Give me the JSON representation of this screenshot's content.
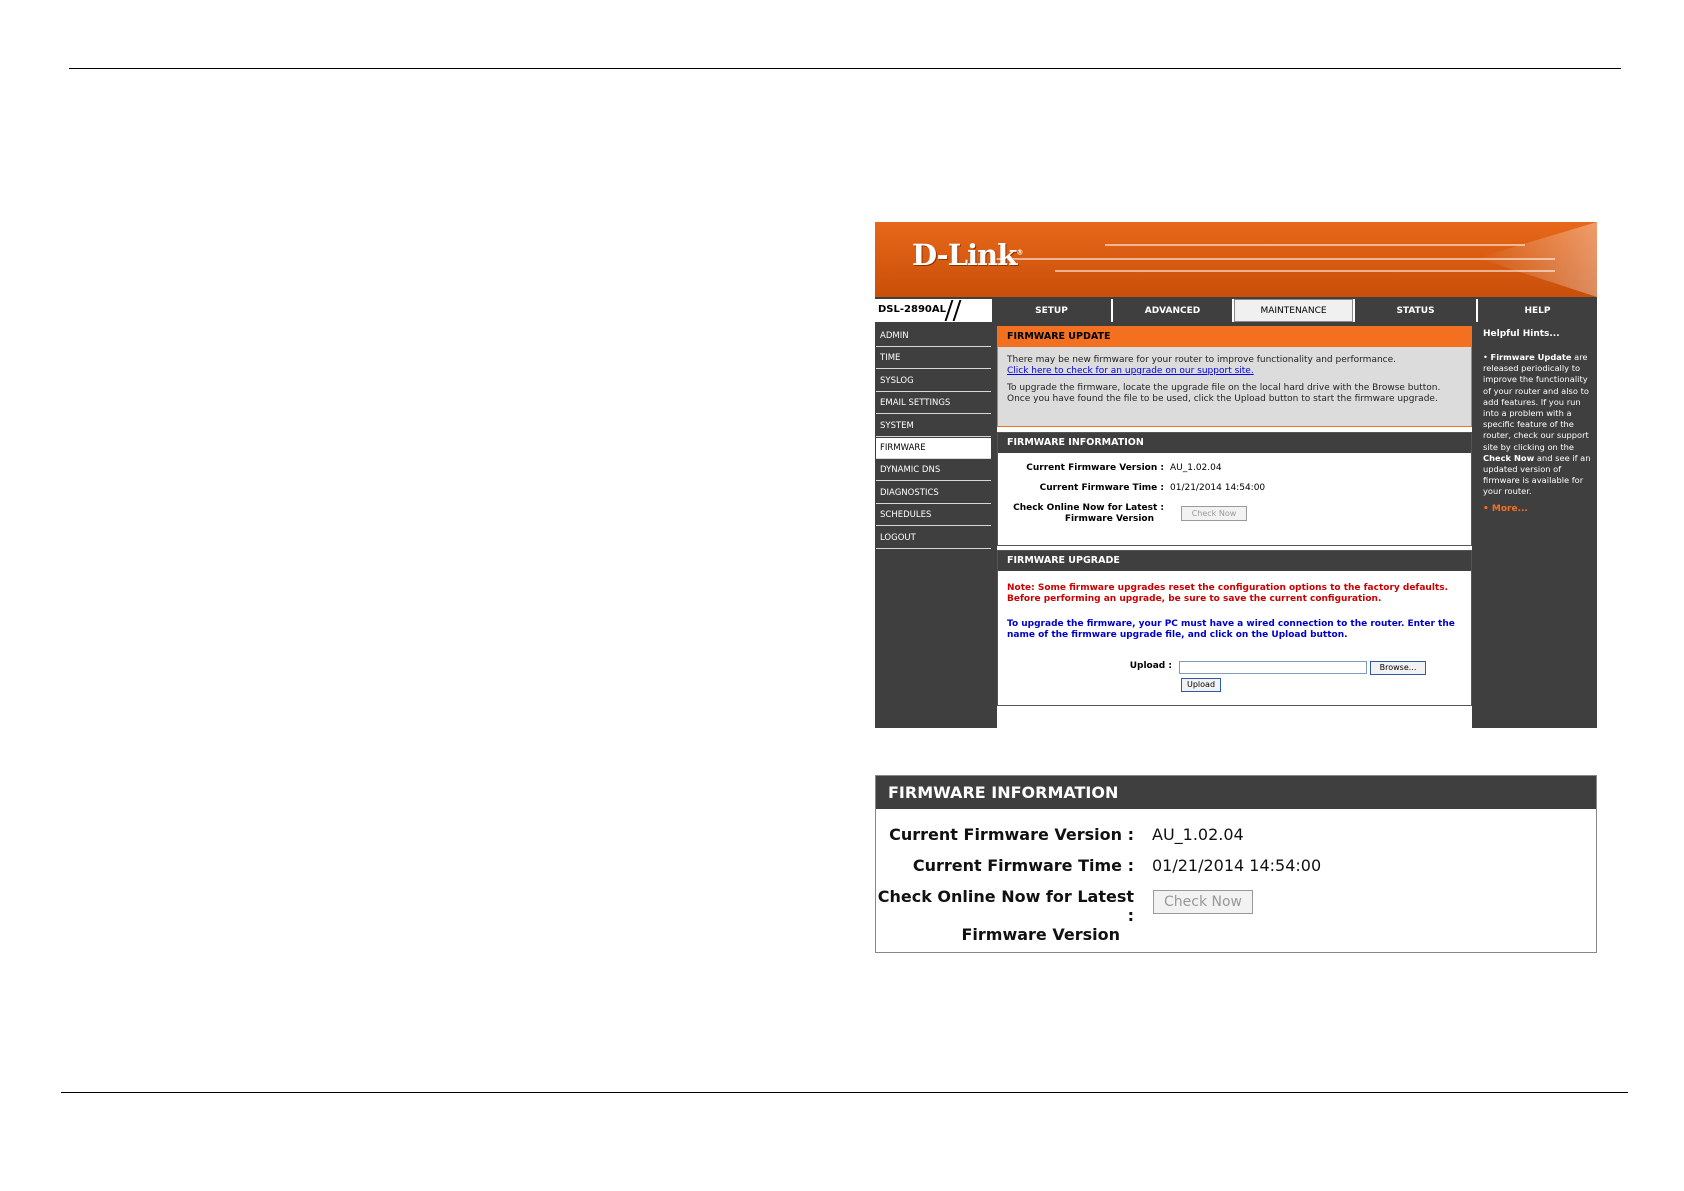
{
  "brand": {
    "logo": "D-Link",
    "model": "DSL-2890AL"
  },
  "nav": {
    "tabs": [
      "SETUP",
      "ADVANCED",
      "MAINTENANCE",
      "STATUS",
      "HELP"
    ],
    "active": "MAINTENANCE"
  },
  "sidebar": {
    "items": [
      "ADMIN",
      "TIME",
      "SYSLOG",
      "EMAIL SETTINGS",
      "SYSTEM",
      "FIRMWARE",
      "DYNAMIC DNS",
      "DIAGNOSTICS",
      "SCHEDULES",
      "LOGOUT"
    ],
    "active": "FIRMWARE"
  },
  "update": {
    "title": "FIRMWARE UPDATE",
    "line1": "There may be new firmware for your router to improve functionality and performance.",
    "link": "Click here to check for an upgrade on our support site.",
    "line2": "To upgrade the firmware, locate the upgrade file on the local hard drive with the Browse button. Once you have found the file to be used, click the Upload button to start the firmware upgrade."
  },
  "info": {
    "title": "FIRMWARE INFORMATION",
    "version_label": "Current Firmware Version :",
    "version_value": "AU_1.02.04",
    "time_label": "Current Firmware Time :",
    "time_value": "01/21/2014 14:54:00",
    "check_label_1": "Check Online Now for Latest :",
    "check_label_2": "Firmware Version",
    "check_button": "Check Now"
  },
  "upgrade": {
    "title": "FIRMWARE UPGRADE",
    "note": "Note: Some firmware upgrades reset the configuration options to the factory defaults. Before performing an upgrade, be sure to save the current configuration.",
    "instructions": "To upgrade the firmware, your PC must have a wired connection to the router. Enter the name of the firmware upgrade file, and click on the Upload button.",
    "upload_label": "Upload :",
    "browse_button": "Browse...",
    "upload_button": "Upload"
  },
  "hints": {
    "title": "Helpful Hints...",
    "bold1": "Firmware Update",
    "text1": " are released periodically to improve the functionality of your router and also to add features. If you run into a problem with a specific feature of the router, check our support site by clicking on the ",
    "bold2": "Check Now",
    "text2": " and see if an updated version of firmware is available for your router.",
    "more": "More..."
  },
  "colors": {
    "orange": "#f37021",
    "dark": "#3f3f3f",
    "note_red": "#cc0000",
    "info_blue": "#0000cc"
  }
}
